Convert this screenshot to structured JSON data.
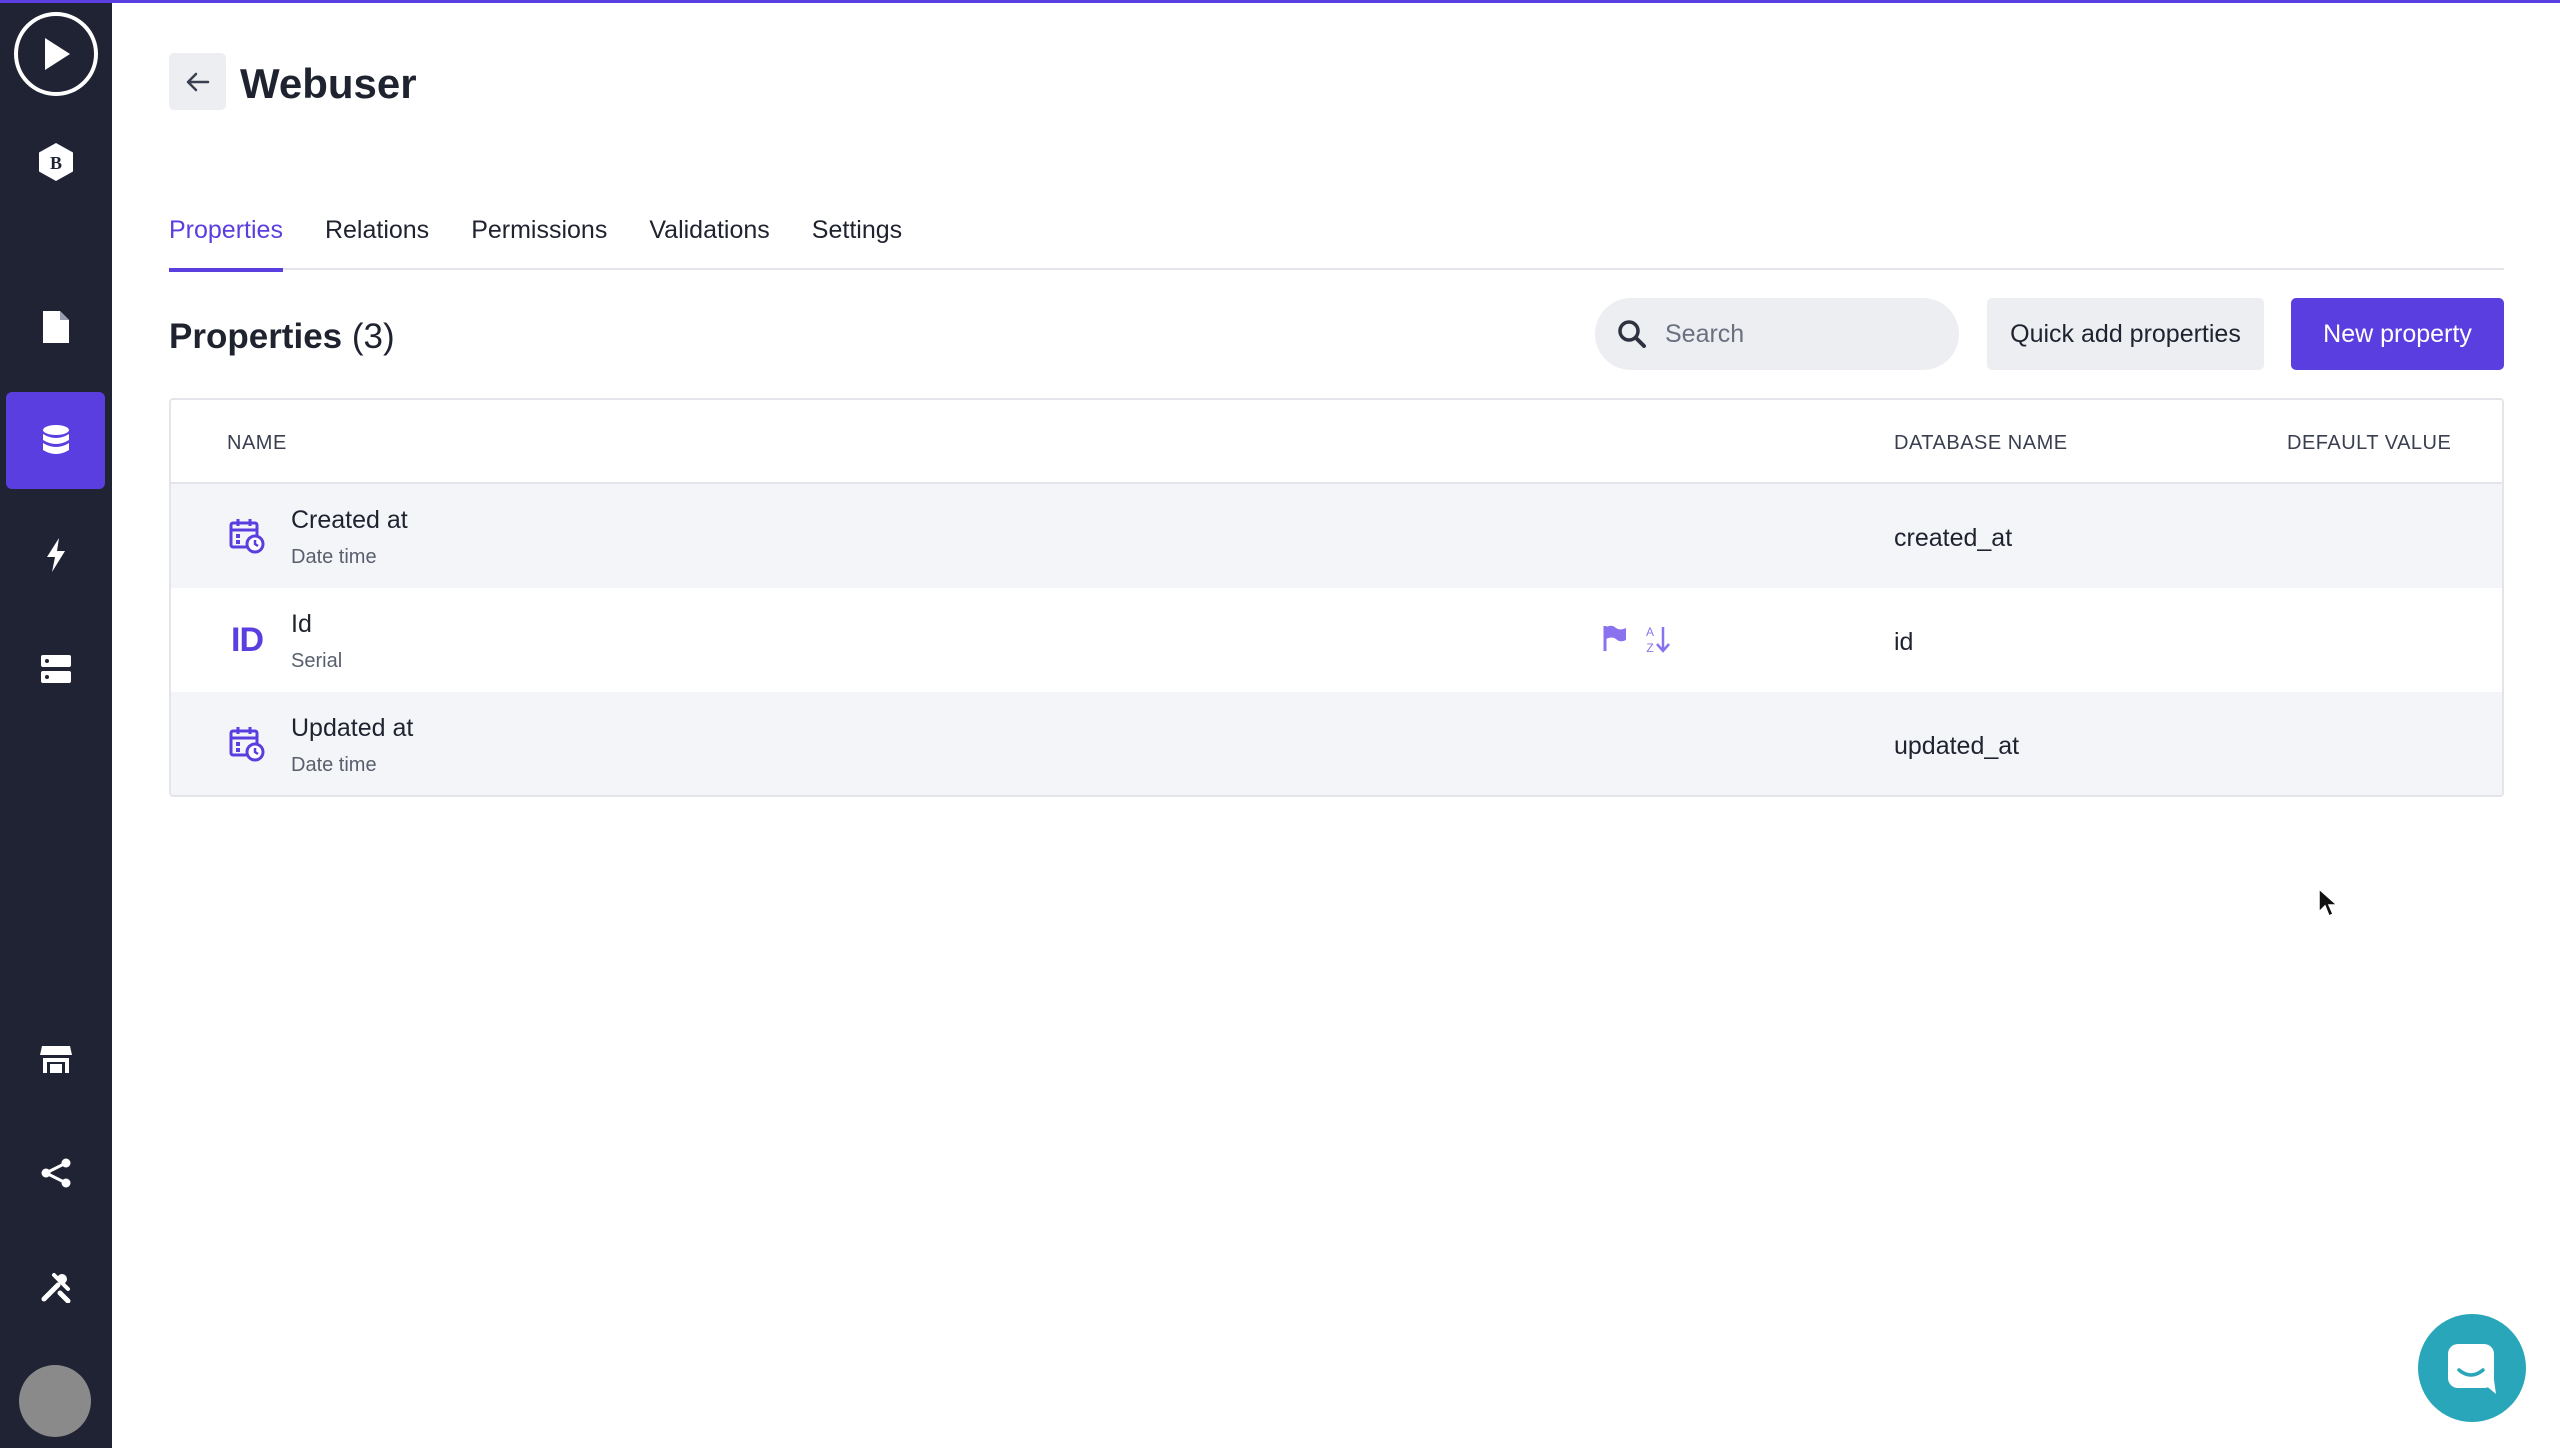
{
  "app": {
    "page_title": "Webuser"
  },
  "tabs": [
    {
      "label": "Properties"
    },
    {
      "label": "Relations"
    },
    {
      "label": "Permissions"
    },
    {
      "label": "Validations"
    },
    {
      "label": "Settings"
    }
  ],
  "section": {
    "title": "Properties",
    "count": "(3)"
  },
  "search": {
    "placeholder": "Search"
  },
  "buttons": {
    "quick_add": "Quick add properties",
    "new_property": "New property"
  },
  "table": {
    "headers": {
      "name": "NAME",
      "database_name": "DATABASE NAME",
      "default_value": "DEFAULT VALUE"
    },
    "rows": [
      {
        "name": "Created at",
        "type": "Date time",
        "db_name": "created_at",
        "icon": "calendar-clock-icon"
      },
      {
        "name": "Id",
        "type": "Serial",
        "db_name": "id",
        "icon": "id-icon",
        "id_label": "ID"
      },
      {
        "name": "Updated at",
        "type": "Date time",
        "db_name": "updated_at",
        "icon": "calendar-clock-icon"
      }
    ]
  },
  "colors": {
    "accent": "#5b3ee0",
    "sidebar": "#1f2333",
    "chat": "#2aa6bb"
  }
}
